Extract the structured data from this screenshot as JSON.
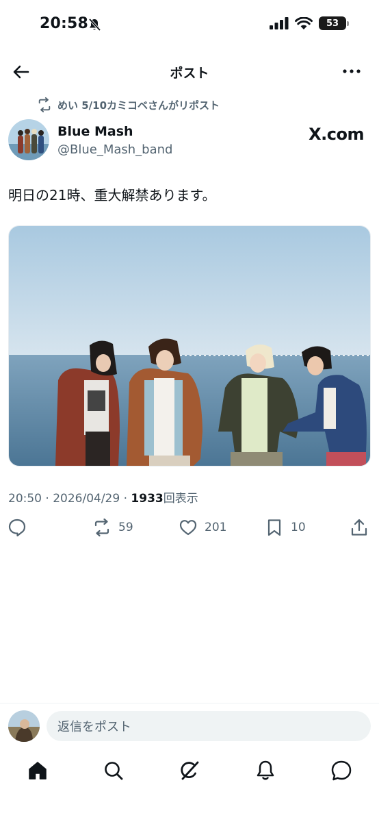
{
  "status_bar": {
    "time": "20:58",
    "battery": "53"
  },
  "nav": {
    "title": "ポスト"
  },
  "repost_note": "めい 5/10カミコベさんがリポスト",
  "author": {
    "name": "Blue Mash",
    "handle": "@Blue_Mash_band",
    "brand": "X.com"
  },
  "post": {
    "text": "明日の21時、重大解禁あります。"
  },
  "meta": {
    "time_date": "20:50 · 2026/04/29 · ",
    "views_count": "1933",
    "views_label": "回表示"
  },
  "actions": {
    "reposts": "59",
    "likes": "201",
    "bookmarks": "10"
  },
  "reply": {
    "placeholder": "返信をポスト"
  },
  "tabbar": [
    "home-icon",
    "search-icon",
    "grok-icon",
    "notifications-icon",
    "messages-icon"
  ],
  "colors": {
    "text": "#0f1419",
    "secondary": "#536471",
    "input_bg": "#eff3f4"
  }
}
